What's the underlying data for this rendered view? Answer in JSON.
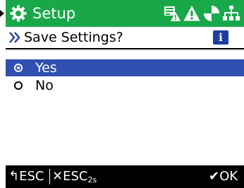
{
  "title_bar": {
    "title": "Setup",
    "background_color": "#18a84a",
    "icons": [
      "gear-icon",
      "network-warning-icon",
      "warning-icon",
      "globe-pie-icon",
      "network-tree-icon"
    ]
  },
  "question": {
    "text": "Save Settings?",
    "info_label": "i",
    "accent_color": "#1e3ea0"
  },
  "options": [
    {
      "label": "Yes",
      "selected": true
    },
    {
      "label": "No",
      "selected": false
    }
  ],
  "highlight_color": "#2f4fb1",
  "footer": {
    "back_arrow": "↰",
    "back_label": "ESC",
    "home_mark": "✕",
    "home_label": "ESC",
    "home_sub": "2s",
    "ok_mark": "✔",
    "ok_label": "OK"
  }
}
